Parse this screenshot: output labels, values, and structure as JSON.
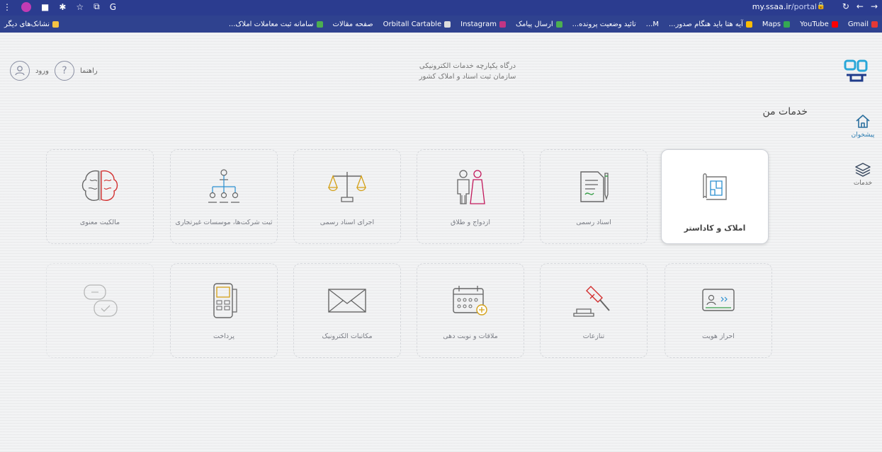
{
  "browser": {
    "url_host": "my.ssaa.ir",
    "url_path": "/portal",
    "bookmarks": [
      {
        "label": "Gmail",
        "color": "#e53935"
      },
      {
        "label": "YouTube",
        "color": "#ff0000"
      },
      {
        "label": "Maps",
        "color": "#34a853"
      },
      {
        "label": "آیه هتا باید هنگام صدور...",
        "color": "#fbbc05"
      },
      {
        "label": "M...",
        "color": "#888888"
      },
      {
        "label": "تائید وضعیت پرونده...",
        "color": "#888888"
      },
      {
        "label": "ارسال پیامک",
        "color": "#4caf50"
      },
      {
        "label": "Instagram",
        "color": "#c13584"
      },
      {
        "label": "Orbitall Cartable",
        "color": "#888888"
      },
      {
        "label": "صفحه مقالات",
        "color": "#999999"
      },
      {
        "label": "سامانه ثبت معاملات املاک...",
        "color": "#4caf50"
      },
      {
        "label": "نشانک‌های دیگر",
        "color": "#f6c343"
      }
    ]
  },
  "header": {
    "portal_title_line1": "درگاه یکپارچه خدمات الکترونیکی",
    "portal_title_line2": "سازمان ثبت اسناد و املاک کشور",
    "help_label": "راهنما",
    "login_label": "ورود",
    "logo_alt": "ثبت من"
  },
  "sidebar": {
    "items": [
      {
        "label": "پیشخوان",
        "icon": "home-icon"
      },
      {
        "label": "خدمات",
        "icon": "layers-icon"
      }
    ]
  },
  "services": {
    "title": "خدمات من",
    "row1": [
      {
        "label": "املاک و کاداستر",
        "icon": "map-plan-icon"
      },
      {
        "label": "اسناد رسمی",
        "icon": "document-pen-icon"
      },
      {
        "label": "ازدواج و طلاق",
        "icon": "wedding-couple-icon"
      },
      {
        "label": "اجرای اسناد رسمی",
        "icon": "scales-icon"
      },
      {
        "label": "ثبت شرکت‌ها، موسسات غیرتجاری",
        "icon": "org-chart-icon"
      },
      {
        "label": "مالکیت معنوی",
        "icon": "brain-icon"
      }
    ],
    "row2": [
      {
        "label": "احراز هویت",
        "icon": "id-card-icon"
      },
      {
        "label": "تنازعات",
        "icon": "gavel-icon"
      },
      {
        "label": "ملاقات و نوبت دهی",
        "icon": "calendar-icon"
      },
      {
        "label": "مکاتبات الکترونیک",
        "icon": "envelope-icon"
      },
      {
        "label": "پرداخت",
        "icon": "pos-terminal-icon"
      },
      {
        "label": "",
        "icon": "chat-icon"
      }
    ]
  },
  "colors": {
    "accent": "#2a7bb0",
    "browser_bar": "#2b3c8f"
  }
}
